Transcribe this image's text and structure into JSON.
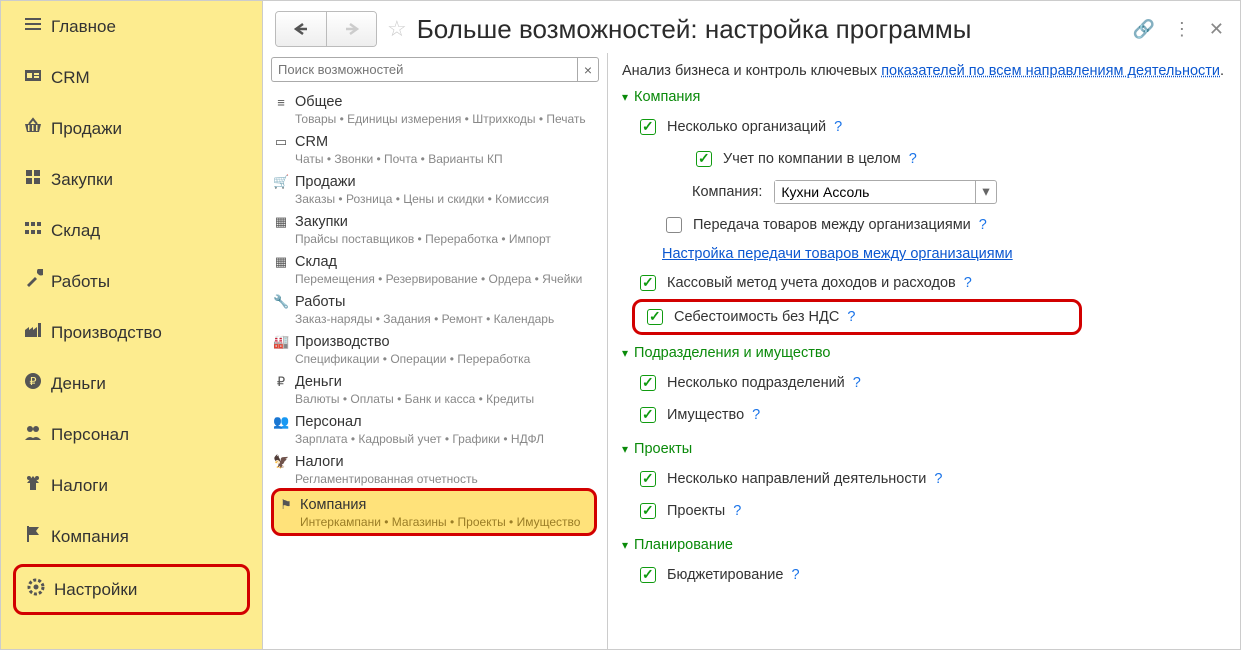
{
  "sidebar": {
    "items": [
      {
        "label": "Главное",
        "icon": "≡"
      },
      {
        "label": "CRM",
        "icon": "crm"
      },
      {
        "label": "Продажи",
        "icon": "basket"
      },
      {
        "label": "Закупки",
        "icon": "stack"
      },
      {
        "label": "Склад",
        "icon": "squares"
      },
      {
        "label": "Работы",
        "icon": "tools"
      },
      {
        "label": "Производство",
        "icon": "factory"
      },
      {
        "label": "Деньги",
        "icon": "money"
      },
      {
        "label": "Персонал",
        "icon": "people"
      },
      {
        "label": "Налоги",
        "icon": "eagle"
      },
      {
        "label": "Компания",
        "icon": "flag"
      },
      {
        "label": "Настройки",
        "icon": "gear",
        "highlighted": true
      }
    ]
  },
  "page": {
    "title": "Больше возможностей: настройка программы",
    "search_placeholder": "Поиск возможностей"
  },
  "categories": [
    {
      "icon": "≡",
      "title": "Общее",
      "sub": "Товары • Единицы измерения • Штрихкоды • Печать"
    },
    {
      "icon": "crm",
      "title": "CRM",
      "sub": "Чаты • Звонки • Почта • Варианты КП"
    },
    {
      "icon": "basket",
      "title": "Продажи",
      "sub": "Заказы • Розница • Цены и скидки • Комиссия"
    },
    {
      "icon": "stack",
      "title": "Закупки",
      "sub": "Прайсы поставщиков • Переработка • Импорт"
    },
    {
      "icon": "squares",
      "title": "Склад",
      "sub": "Перемещения • Резервирование • Ордера • Ячейки"
    },
    {
      "icon": "tools",
      "title": "Работы",
      "sub": "Заказ-наряды • Задания • Ремонт • Календарь"
    },
    {
      "icon": "factory",
      "title": "Производство",
      "sub": "Спецификации • Операции • Переработка"
    },
    {
      "icon": "money",
      "title": "Деньги",
      "sub": "Валюты • Оплаты • Банк и касса • Кредиты"
    },
    {
      "icon": "people",
      "title": "Персонал",
      "sub": "Зарплата • Кадровый учет • Графики • НДФЛ"
    },
    {
      "icon": "eagle",
      "title": "Налоги",
      "sub": "Регламентированная отчетность"
    },
    {
      "icon": "flag",
      "title": "Компания",
      "sub": "Интеркампани • Магазины • Проекты • Имущество",
      "highlighted": true
    }
  ],
  "detail": {
    "intro_text": "Анализ бизнеса и контроль ключевых ",
    "intro_link": "показателей по всем направлениям деятельности",
    "sections": {
      "company": {
        "title": "Компания",
        "multiple_orgs": "Несколько организаций",
        "by_company_whole": "Учет по компании в целом",
        "company_label": "Компания:",
        "company_value": "Кухни Ассоль",
        "transfer_goods": "Передача товаров между организациями",
        "transfer_link": "Настройка передачи товаров между организациями",
        "cash_method": "Кассовый метод учета доходов и расходов",
        "cost_no_vat": "Себестоимость без НДС"
      },
      "subdivisions": {
        "title": "Подразделения и имущество",
        "multiple_subdiv": "Несколько подразделений",
        "assets": "Имущество"
      },
      "projects": {
        "title": "Проекты",
        "multiple_dir": "Несколько направлений деятельности",
        "projects": "Проекты"
      },
      "planning": {
        "title": "Планирование",
        "budgeting": "Бюджетирование"
      }
    }
  }
}
